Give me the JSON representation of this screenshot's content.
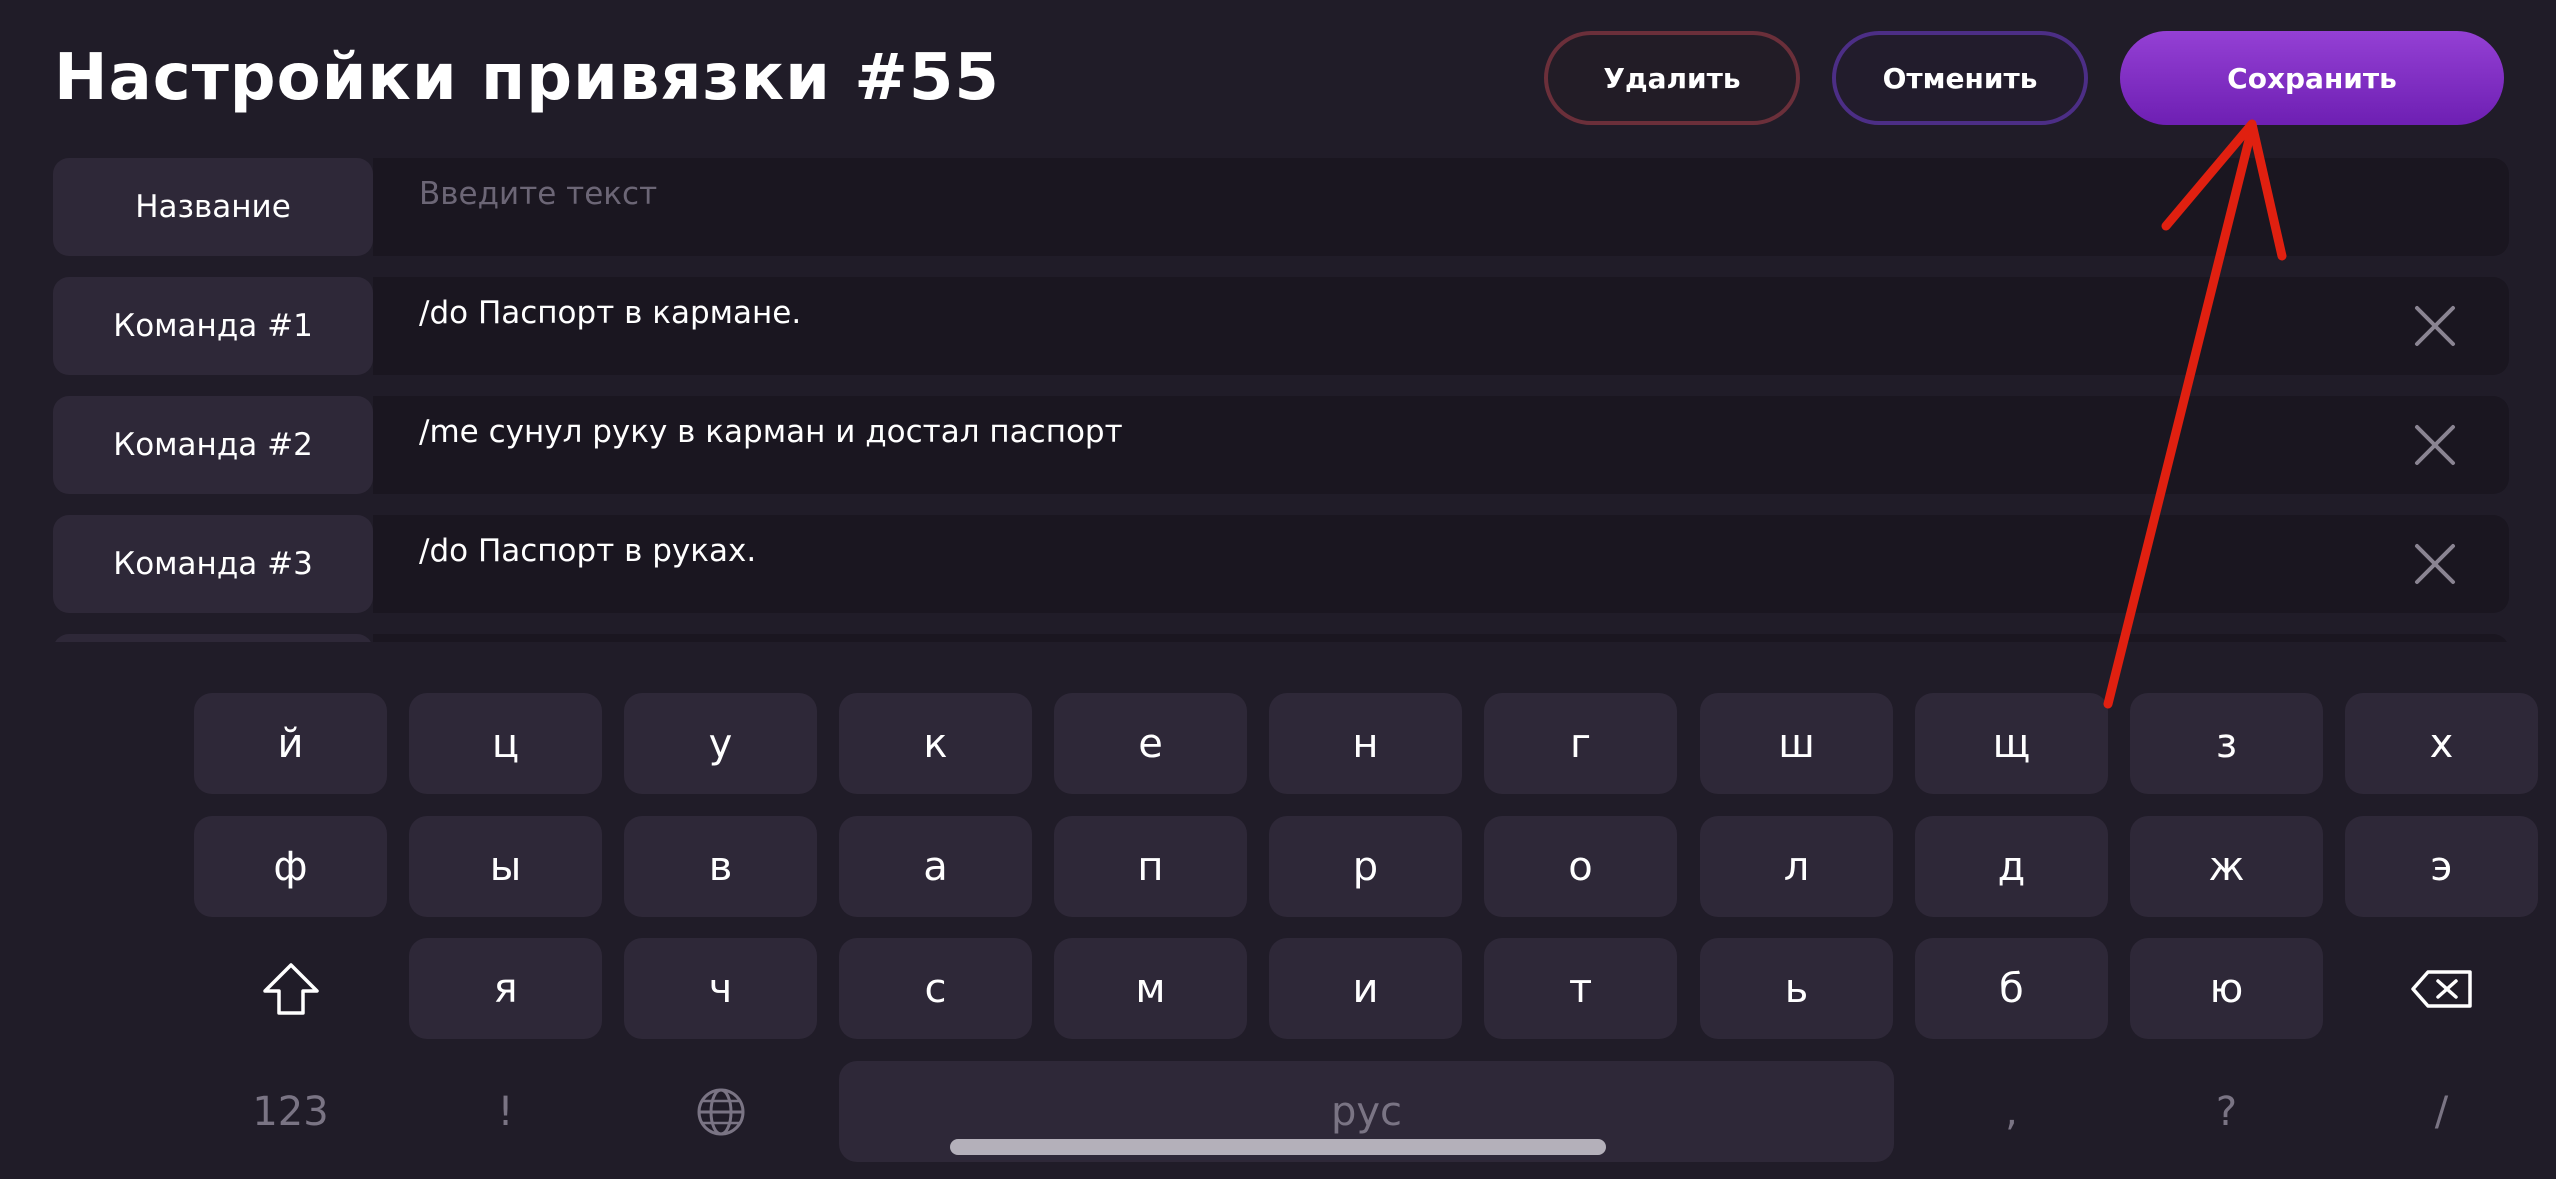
{
  "header": {
    "title": "Настройки привязки #55",
    "delete_label": "Удалить",
    "cancel_label": "Отменить",
    "save_label": "Сохранить"
  },
  "form": {
    "name_row": {
      "label": "Название",
      "value": "",
      "placeholder": "Введите текст"
    },
    "commands": [
      {
        "label": "Команда #1",
        "value": "/do Паспорт в кармане."
      },
      {
        "label": "Команда #2",
        "value": "/me сунул руку в карман и достал паспорт"
      },
      {
        "label": "Команда #3",
        "value": "/do Паспорт в руках."
      }
    ]
  },
  "keyboard": {
    "row1": [
      "й",
      "ц",
      "у",
      "к",
      "е",
      "н",
      "г",
      "ш",
      "щ",
      "з",
      "х"
    ],
    "row2": [
      "ф",
      "ы",
      "в",
      "а",
      "п",
      "р",
      "о",
      "л",
      "д",
      "ж",
      "э"
    ],
    "row3": [
      "я",
      "ч",
      "с",
      "м",
      "и",
      "т",
      "ь",
      "б",
      "ю"
    ],
    "bottom": {
      "numbers": "123",
      "exclaim": "!",
      "space": "рус",
      "comma": ",",
      "question": "?",
      "slash": "/"
    },
    "icons": {
      "shift": "shift-icon",
      "backspace": "backspace-icon",
      "globe": "globe-icon"
    }
  },
  "colors": {
    "background": "#201c28",
    "save_button": "#8a36c8",
    "delete_border": "#6b2f3a",
    "cancel_border": "#4c2e86",
    "annotation_arrow": "#e02010"
  }
}
